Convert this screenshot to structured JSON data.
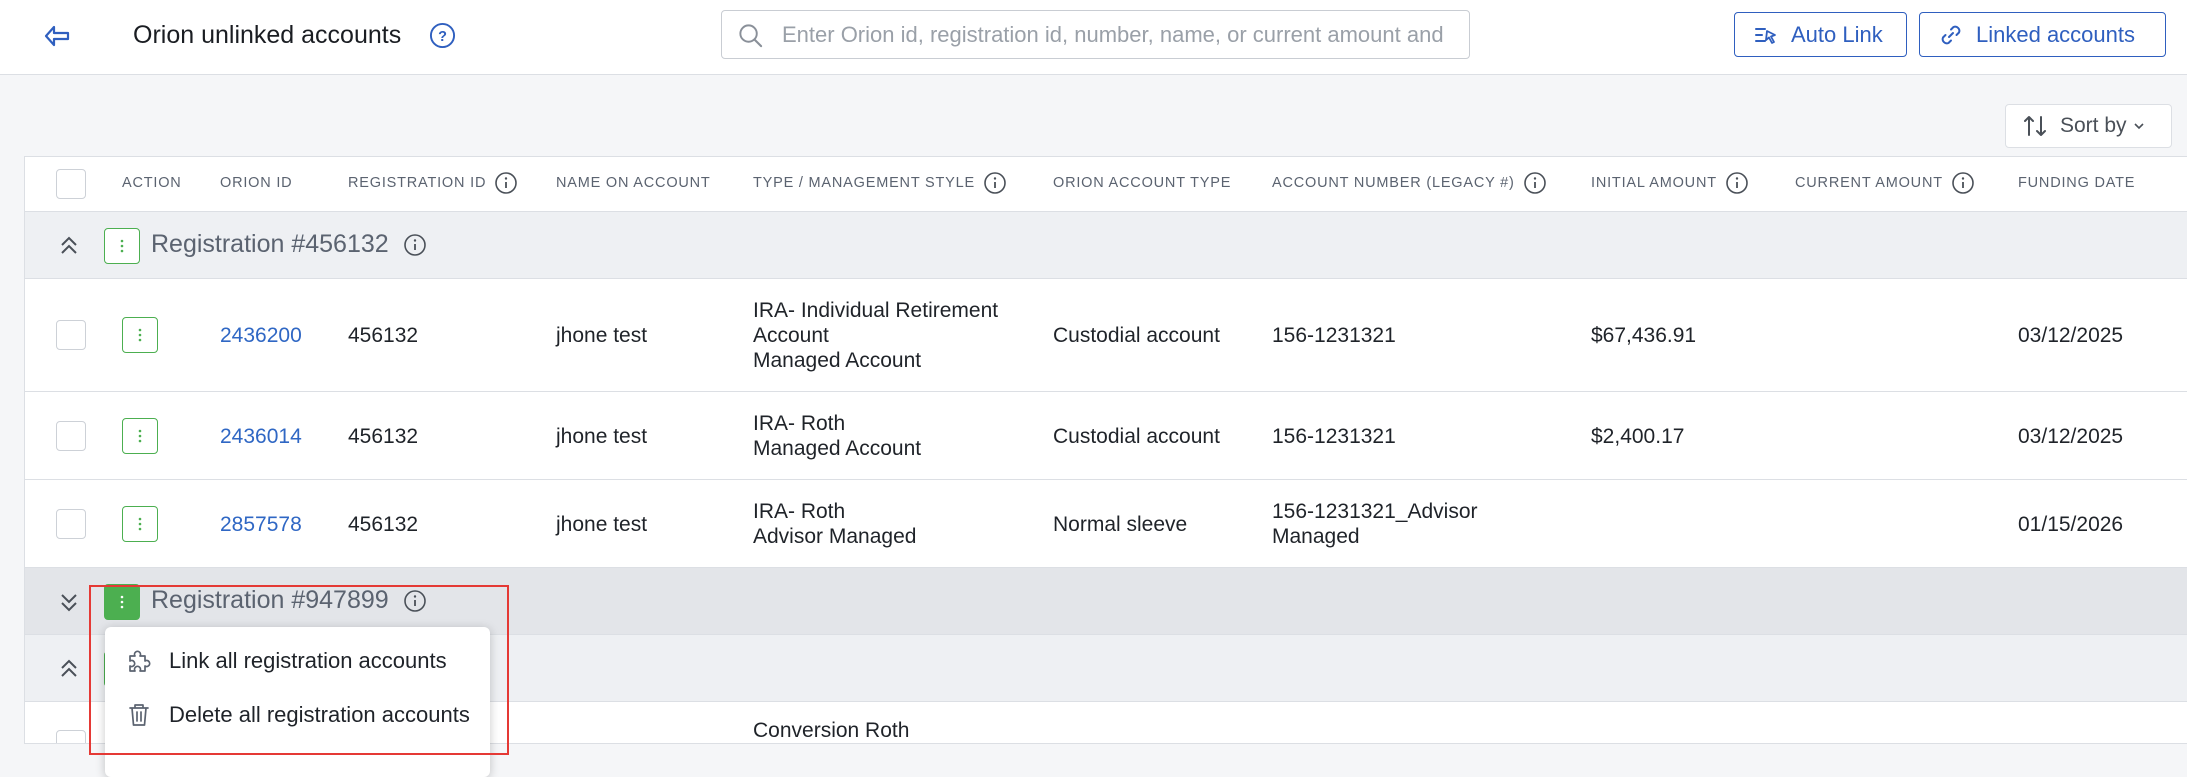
{
  "header": {
    "title": "Orion unlinked accounts",
    "search_placeholder": "Enter Orion id, registration id, number, name, or current amount and",
    "auto_link_label": "Auto Link",
    "linked_accounts_label": "Linked accounts",
    "accent": "#2f5fbf"
  },
  "toolbar": {
    "sort_label": "Sort by"
  },
  "table": {
    "columns": {
      "action": "ACTION",
      "orion_id": "ORION ID",
      "registration_id": "REGISTRATION ID",
      "name_on_account": "NAME ON ACCOUNT",
      "type_style": "TYPE / MANAGEMENT STYLE",
      "orion_account_type": "ORION ACCOUNT TYPE",
      "account_number": "ACCOUNT NUMBER (LEGACY #)",
      "initial_amount": "INITIAL AMOUNT",
      "current_amount": "CURRENT AMOUNT",
      "funding_date": "FUNDING DATE"
    },
    "groups": [
      {
        "title": "Registration #456132",
        "rows": [
          {
            "orion_id": "2436200",
            "registration_id": "456132",
            "name": "jhone test",
            "type_lines": [
              "IRA- Individual Retirement",
              "Account",
              "Managed Account"
            ],
            "orion_account_type": "Custodial account",
            "account_number_lines": [
              "156-1231321"
            ],
            "initial_amount": "$67,436.91",
            "current_amount": "",
            "funding_date": "03/12/2025"
          },
          {
            "orion_id": "2436014",
            "registration_id": "456132",
            "name": "jhone test",
            "type_lines": [
              "IRA- Roth",
              "Managed Account"
            ],
            "orion_account_type": "Custodial account",
            "account_number_lines": [
              "156-1231321"
            ],
            "initial_amount": "$2,400.17",
            "current_amount": "",
            "funding_date": "03/12/2025"
          },
          {
            "orion_id": "2857578",
            "registration_id": "456132",
            "name": "jhone test",
            "type_lines": [
              "IRA- Roth",
              "Advisor Managed"
            ],
            "orion_account_type": "Normal sleeve",
            "account_number_lines": [
              "156-1231321_Advisor",
              "Managed"
            ],
            "initial_amount": "",
            "current_amount": "",
            "funding_date": "01/15/2026"
          }
        ]
      },
      {
        "title": "Registration #947899"
      }
    ],
    "partial_row": {
      "type_line": "Conversion Roth"
    }
  },
  "menu": {
    "items": [
      {
        "label": "Link all registration accounts",
        "icon": "puzzle-icon"
      },
      {
        "label": "Delete all registration accounts",
        "icon": "trash-icon"
      }
    ]
  },
  "colors": {
    "link": "#2f67c4",
    "kebab_green": "#4caf50",
    "highlight_red": "#e53935"
  }
}
